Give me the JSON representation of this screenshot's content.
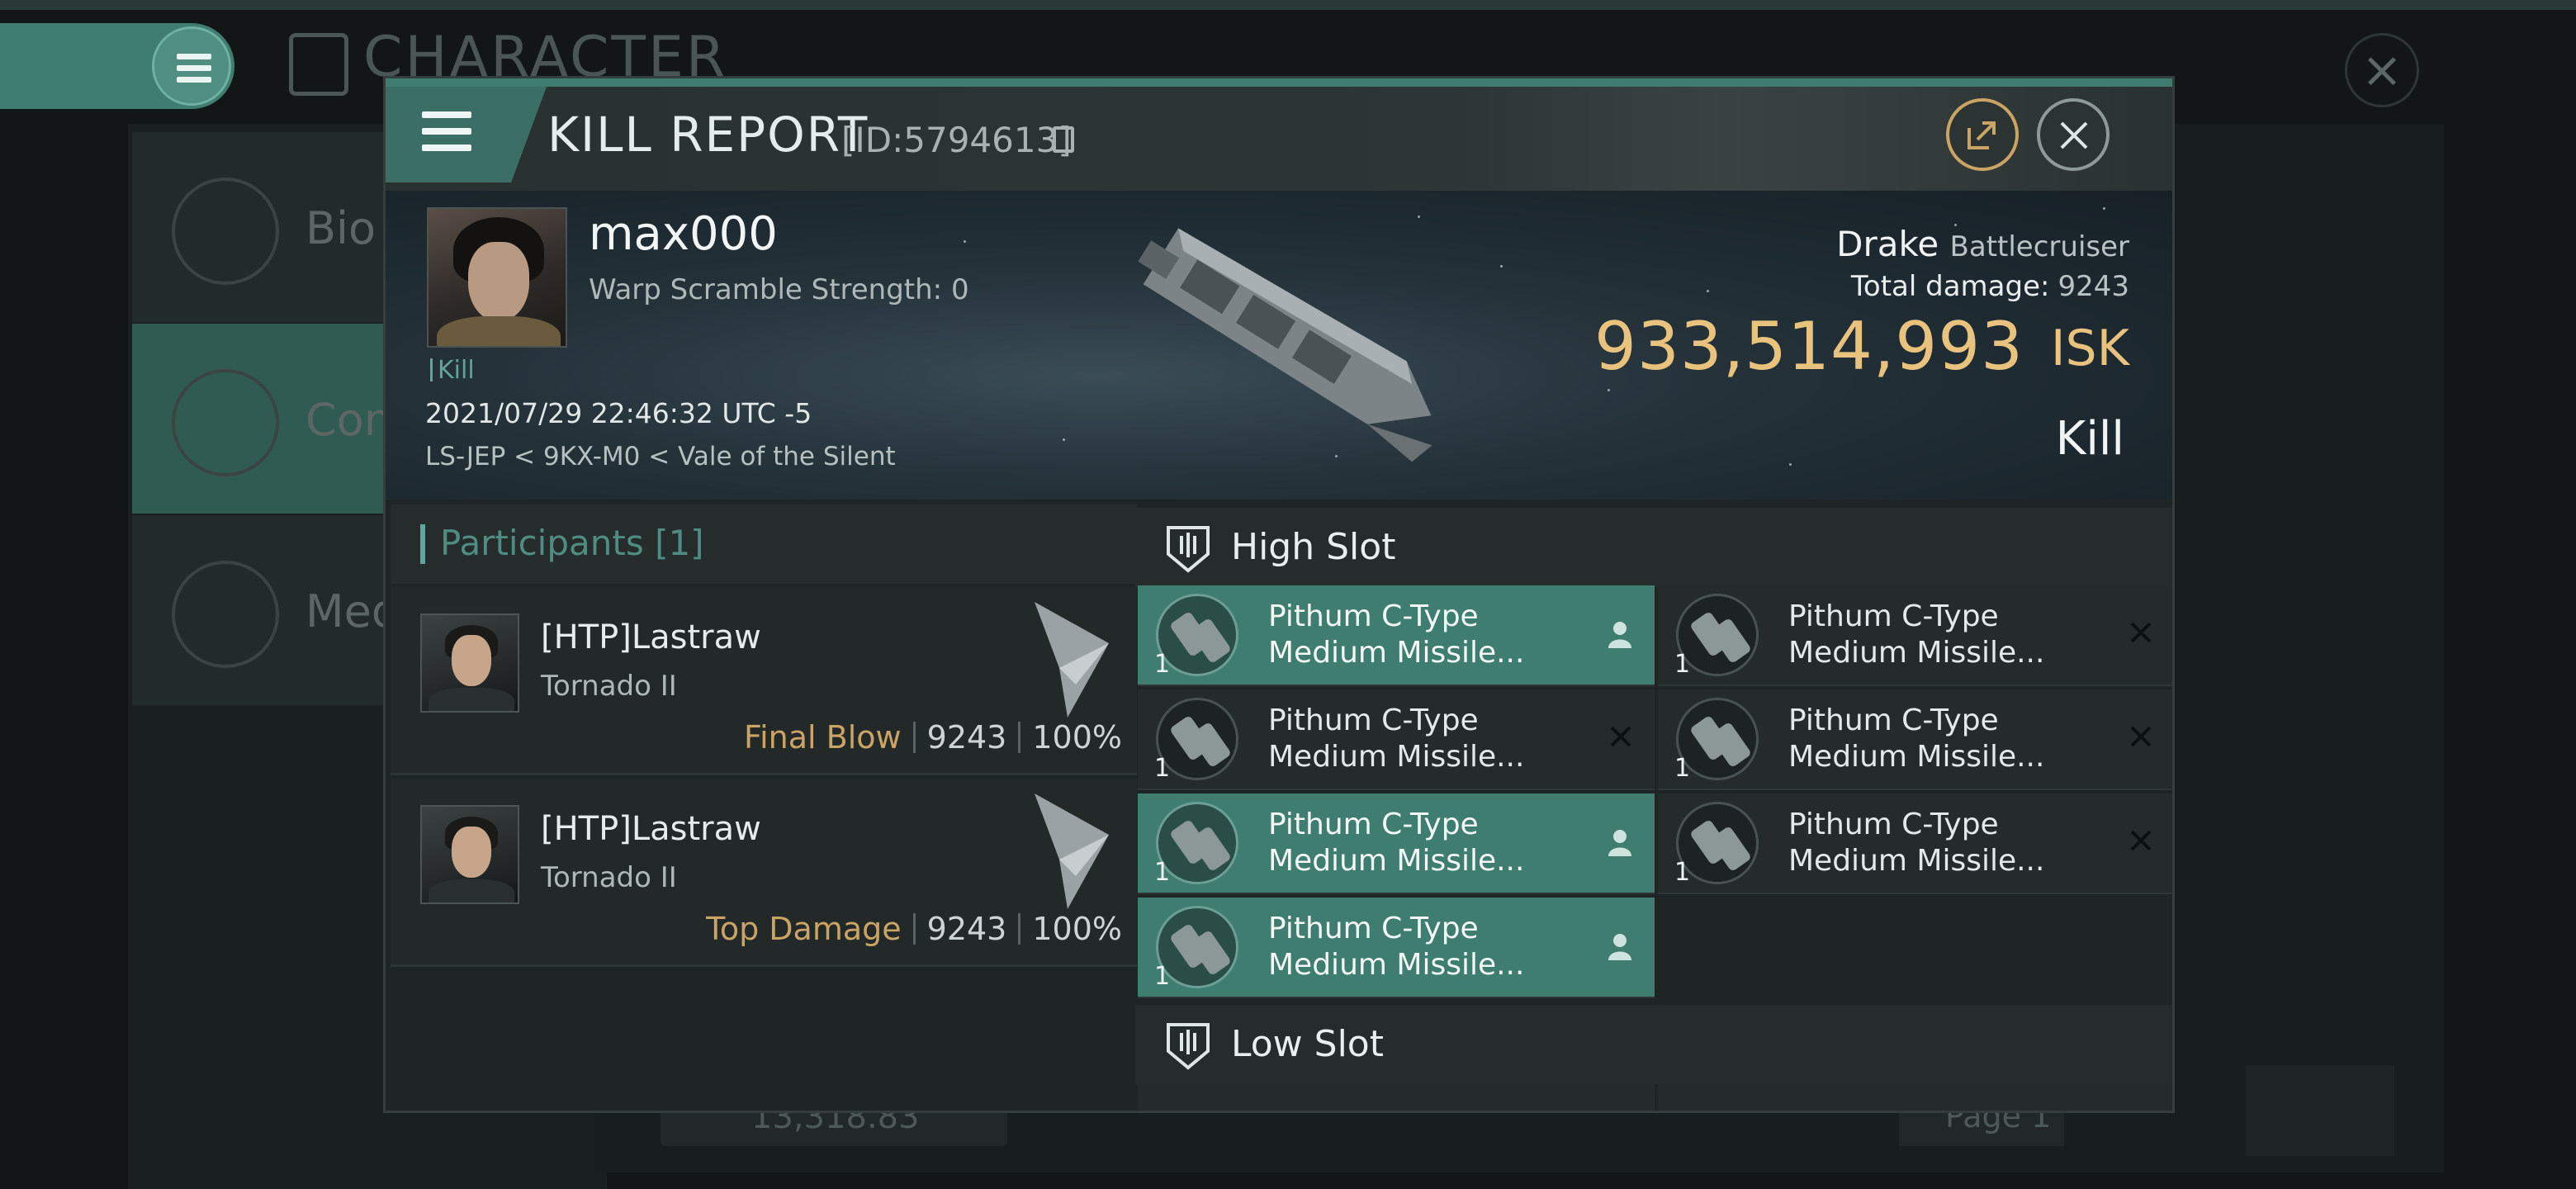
{
  "background": {
    "title": "CHARACTER",
    "sidebar": [
      {
        "label": "Bio"
      },
      {
        "label": "Com"
      },
      {
        "label": "Med"
      }
    ],
    "bottom_stat": "13,318.83",
    "bottom_page": "Page 1"
  },
  "dialog": {
    "title": "KILL REPORT",
    "id": "[ID:5794613]",
    "victim": {
      "name": "max000",
      "warp": "Warp Scramble Strength: 0",
      "tag": "Kill",
      "time": "2021/07/29 22:46:32 UTC -5",
      "location": "LS-JEP < 9KX-M0 < Vale of the Silent"
    },
    "ship": {
      "name": "Drake",
      "class": "Battlecruiser",
      "total_damage_label": "Total damage:",
      "total_damage": "9243",
      "isk_value": "933,514,993",
      "isk_unit": "ISK",
      "result": "Kill"
    },
    "participants": {
      "label": "Participants",
      "count": "[1]",
      "rows": [
        {
          "name": "[HTP]Lastraw",
          "ship": "Tornado II",
          "tag": "Final Blow",
          "damage": "9243",
          "percent": "100%"
        },
        {
          "name": "[HTP]Lastraw",
          "ship": "Tornado II",
          "tag": "Top Damage",
          "damage": "9243",
          "percent": "100%"
        }
      ]
    },
    "high_slot": {
      "label": "High Slot",
      "modules": [
        {
          "line1": "Pithum C-Type",
          "line2": "Medium Missile...",
          "qty": "1",
          "status": "dropped"
        },
        {
          "line1": "Pithum C-Type",
          "line2": "Medium Missile...",
          "qty": "1",
          "status": "destroyed"
        },
        {
          "line1": "Pithum C-Type",
          "line2": "Medium Missile...",
          "qty": "1",
          "status": "destroyed"
        },
        {
          "line1": "Pithum C-Type",
          "line2": "Medium Missile...",
          "qty": "1",
          "status": "destroyed"
        },
        {
          "line1": "Pithum C-Type",
          "line2": "Medium Missile...",
          "qty": "1",
          "status": "dropped"
        },
        {
          "line1": "Pithum C-Type",
          "line2": "Medium Missile...",
          "qty": "1",
          "status": "destroyed"
        },
        {
          "line1": "Pithum C-Type",
          "line2": "Medium Missile...",
          "qty": "1",
          "status": "dropped"
        }
      ]
    },
    "low_slot": {
      "label": "Low Slot"
    }
  },
  "colors": {
    "accent": "#3f7d70",
    "isk": "#e9c37e",
    "tag_gold": "#c9a464"
  }
}
